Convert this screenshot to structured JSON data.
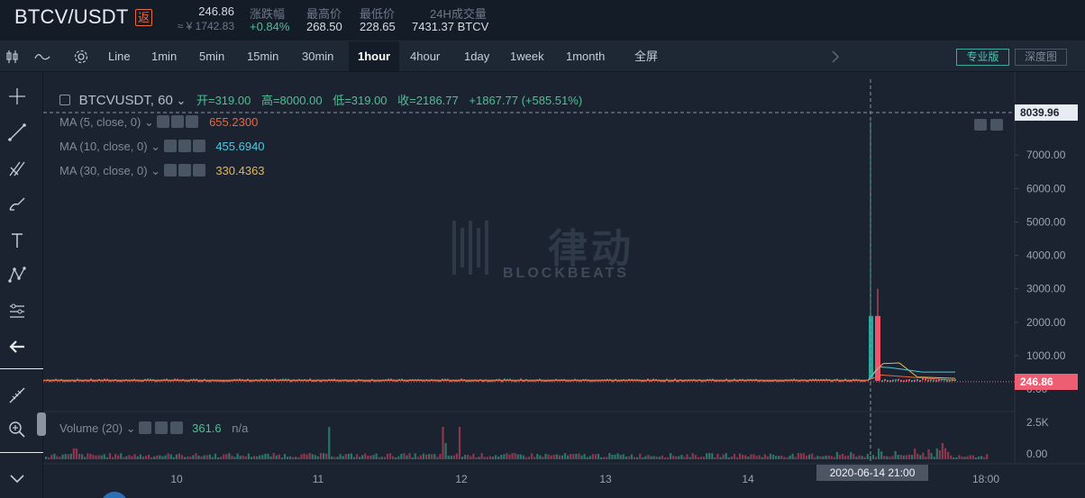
{
  "header": {
    "pair": "BTCV/USDT",
    "rebate_badge": "返",
    "last_price": "246.86",
    "cny_price": "≈ ¥ 1742.83",
    "stats": [
      {
        "label": "涨跌幅",
        "value": "+0.84%",
        "color": "#4fbf96"
      },
      {
        "label": "最高价",
        "value": "268.50",
        "color": "#d7dde5"
      },
      {
        "label": "最低价",
        "value": "228.65",
        "color": "#d7dde5"
      },
      {
        "label": "24H成交量",
        "value": "7431.37 BTCV",
        "color": "#d7dde5"
      }
    ]
  },
  "toolbar": {
    "intervals": [
      "Line",
      "1min",
      "5min",
      "15min",
      "30min",
      "1hour",
      "4hour",
      "1day",
      "1week",
      "1month",
      "全屏"
    ],
    "active_interval": "1hour",
    "pro_label": "专业版",
    "depth_label": "深度图"
  },
  "chart": {
    "symbol_label": "BTCVUSDT, 60",
    "ohlc": {
      "open": "开=319.00",
      "high": "高=8000.00",
      "low": "低=319.00",
      "close": "收=2186.77",
      "change": "+1867.77 (+585.51%)"
    },
    "ma": [
      {
        "label": "MA (5, close, 0)",
        "value": "655.2300",
        "color": "#e9673f"
      },
      {
        "label": "MA (10, close, 0)",
        "value": "455.6940",
        "color": "#4ec9e2"
      },
      {
        "label": "MA (30, close, 0)",
        "value": "330.4363",
        "color": "#e9b44c"
      }
    ],
    "volume": {
      "label": "Volume (20)",
      "value": "361.6",
      "extra": "n/a"
    },
    "price_axis": [
      "7000.00",
      "6000.00",
      "5000.00",
      "4000.00",
      "3000.00",
      "2000.00",
      "1000.00",
      "0.00"
    ],
    "volume_axis": [
      "2.5K",
      "0.00"
    ],
    "time_axis": [
      "10",
      "11",
      "12",
      "13",
      "14",
      "18:00"
    ],
    "crosshair_price": "8039.96",
    "last_price_tag": "246.86",
    "crosshair_time": "2020-06-14   21:00",
    "watermark_brand": "BLOCKBEATS",
    "watermark_cn": "律动"
  },
  "chart_data": {
    "type": "candlestick",
    "interval": "1hour",
    "ylim": [
      0,
      8300
    ],
    "highlight_candle": {
      "time": "2020-06-14 21:00",
      "open": 319.0,
      "high": 8000.0,
      "low": 319.0,
      "close": 2186.77
    },
    "next_candle": {
      "open": 2186.77,
      "high": 3000,
      "low": 240,
      "close": 246.86
    },
    "baseline_price": 260,
    "colors": {
      "up": "#26a69a",
      "down": "#ef5369"
    }
  }
}
